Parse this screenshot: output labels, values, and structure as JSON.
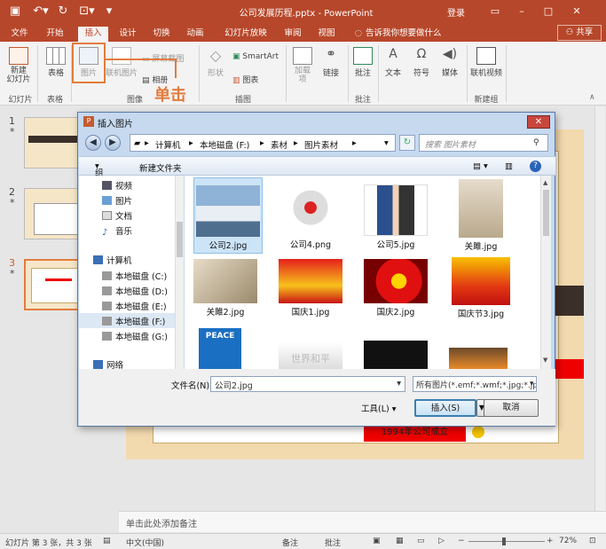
{
  "app": {
    "title": "公司发展历程.pptx - PowerPoint",
    "login": "登录",
    "share": "共享"
  },
  "tabs": [
    "文件",
    "开始",
    "插入",
    "设计",
    "切换",
    "动画",
    "幻灯片放映",
    "审阅",
    "视图"
  ],
  "tell_me": "告诉我你想要做什么",
  "ribbon": {
    "buttons": {
      "new_slide": "新建\n幻灯片",
      "table": "表格",
      "picture": "图片",
      "online_picture": "联机图片",
      "screenshot": "屏幕截图",
      "album": "相册",
      "shapes": "形状",
      "smartart": "SmartArt",
      "chart": "图表",
      "addins": "加载\n项",
      "link": "链接",
      "comment": "批注",
      "text": "文本",
      "symbol": "符号",
      "media": "媒体",
      "online_video": "联机视频"
    },
    "groups": {
      "slides": "幻灯片",
      "tables": "表格",
      "images": "图像",
      "illustrations": "插图",
      "comments": "批注",
      "new_group": "新建组"
    }
  },
  "annotation": "单击",
  "slide_numbers": [
    "1",
    "2",
    "3"
  ],
  "slide_text": "1994年公司成立",
  "notes": "单击此处添加备注",
  "status": {
    "slide": "幻灯片 第 3 张，共 3 张",
    "lang": "中文(中国)",
    "notes": "备注",
    "comments": "批注",
    "zoom": "72%"
  },
  "dialog": {
    "title": "插入图片",
    "path": [
      "计算机",
      "本地磁盘 (F:)",
      "素材",
      "图片素材"
    ],
    "search_placeholder": "搜索 图片素材",
    "organize": "组织",
    "new_folder": "新建文件夹",
    "nav": [
      "视频",
      "图片",
      "文档",
      "音乐",
      "计算机",
      "本地磁盘 (C:)",
      "本地磁盘 (D:)",
      "本地磁盘 (E:)",
      "本地磁盘 (F:)",
      "本地磁盘 (G:)",
      "网络"
    ],
    "files": [
      "公司2.jpg",
      "公司4.png",
      "公司5.jpg",
      "关雎.jpg",
      "关雎2.jpg",
      "国庆1.jpg",
      "国庆2.jpg",
      "国庆节3.jpg",
      "PEACE",
      "世界和平",
      "",
      ""
    ],
    "filename_label": "文件名(N):",
    "filename": "公司2.jpg",
    "filetype": "所有图片(*.emf;*.wmf;*.jpg;*.jp",
    "tools": "工具(L)",
    "insert": "插入(S)",
    "cancel": "取消"
  }
}
